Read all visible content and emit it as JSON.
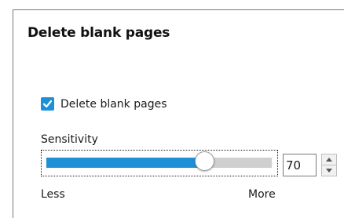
{
  "section": {
    "title": "Delete blank pages"
  },
  "delete_blank_pages": {
    "label": "Delete blank pages",
    "checked": true
  },
  "sensitivity": {
    "label": "Sensitivity",
    "value": "70",
    "level": 0.7,
    "min_label": "Less",
    "max_label": "More"
  },
  "icons": {
    "checkbox": "checkmark-icon",
    "spin_up": "triangle-up-icon",
    "spin_down": "triangle-down-icon"
  },
  "colors": {
    "accent": "#1e90d8",
    "track": "#cfcfcf"
  }
}
